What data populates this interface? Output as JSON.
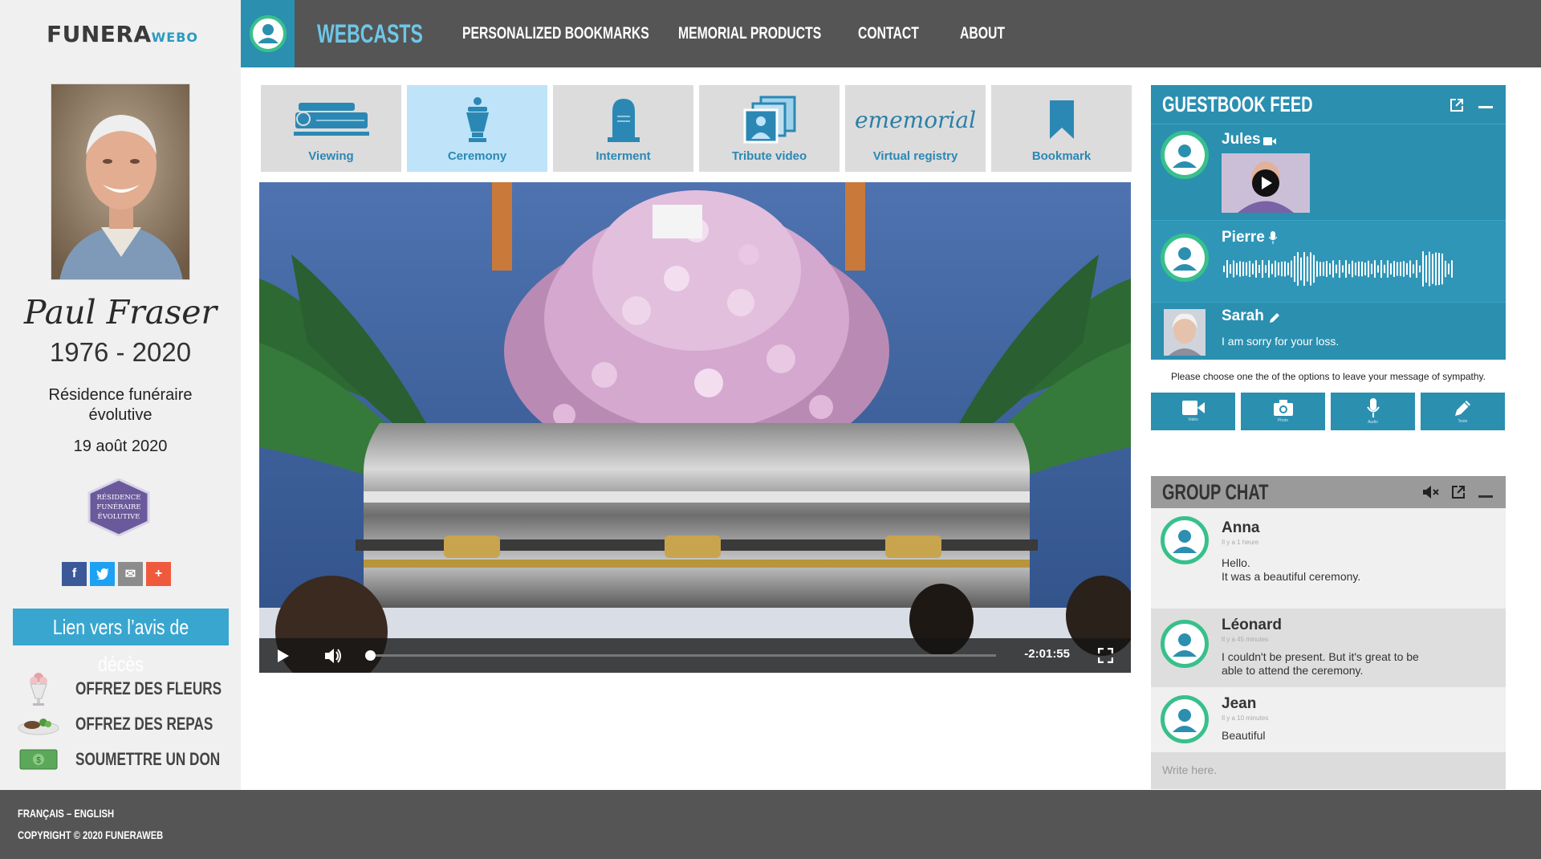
{
  "logo": {
    "main": "FUNERA",
    "suffix": "WEBO"
  },
  "deceased": {
    "name": "Paul Fraser",
    "years": "1976 - 2020",
    "home": "Résidence funéraire évolutive",
    "date": "19 août 2020",
    "badge_lines": [
      "RÉSIDENCE",
      "FUNÉRAIRE",
      "ÉVOLUTIVE"
    ]
  },
  "social": {
    "facebook": "f",
    "twitter": "t",
    "email": "✉",
    "plus": "+"
  },
  "obituary_link": "Lien vers l’avis de décès",
  "sidebar_actions": [
    {
      "label": "OFFREZ DES FLEURS",
      "icon": "flower-vase-icon"
    },
    {
      "label": "OFFREZ DES REPAS",
      "icon": "meal-plate-icon"
    },
    {
      "label": "SOUMETTRE UN DON",
      "icon": "money-bill-icon"
    }
  ],
  "nav": {
    "active": "WEBCASTS",
    "items": [
      "PERSONALIZED BOOKMARKS",
      "MEMORIAL PRODUCTS",
      "CONTACT",
      "ABOUT"
    ]
  },
  "tabs": [
    {
      "label": "Viewing",
      "icon": "casket-icon"
    },
    {
      "label": "Ceremony",
      "icon": "urn-icon",
      "active": true
    },
    {
      "label": "Interment",
      "icon": "tombstone-icon"
    },
    {
      "label": "Tribute video",
      "icon": "photo-stack-icon"
    },
    {
      "label": "Virtual registry",
      "brand": "ememorial"
    },
    {
      "label": "Bookmark",
      "icon": "bookmark-icon"
    }
  ],
  "video": {
    "time": "-2:01:55",
    "progress": 0.0
  },
  "guestbook": {
    "title": "GUESTBOOK FEED",
    "entries": [
      {
        "name": "Jules",
        "type": "video"
      },
      {
        "name": "Pierre",
        "type": "audio"
      },
      {
        "name": "Sarah",
        "type": "text",
        "message": "I am sorry for your loss."
      }
    ],
    "hint": "Please choose one the of the options to leave your message of sympathy.",
    "buttons": [
      "Vidéo",
      "Photo",
      "Audio",
      "Texte"
    ]
  },
  "chat": {
    "title": "GROUP CHAT",
    "messages": [
      {
        "name": "Anna",
        "time": "Il y a 1 heure",
        "text": [
          "Hello.",
          "It was a beautiful ceremony."
        ]
      },
      {
        "name": "Léonard",
        "time": "Il y a 45 minutes",
        "text": [
          "I couldn't be present. But it's great to be",
          "able to attend the ceremony."
        ]
      },
      {
        "name": "Jean",
        "time": "Il y a 10 minutes",
        "text": [
          "Beautiful"
        ]
      }
    ],
    "placeholder": "Write here."
  },
  "footer": {
    "languages": "FRANÇAIS – ENGLISH",
    "copyright": "COPYRIGHT © 2020 FUNERAWEB"
  },
  "colors": {
    "accent": "#2b8fb0",
    "light_blue": "#39a6cf",
    "green_ring": "#38c08c",
    "nav_bg": "#555555"
  }
}
